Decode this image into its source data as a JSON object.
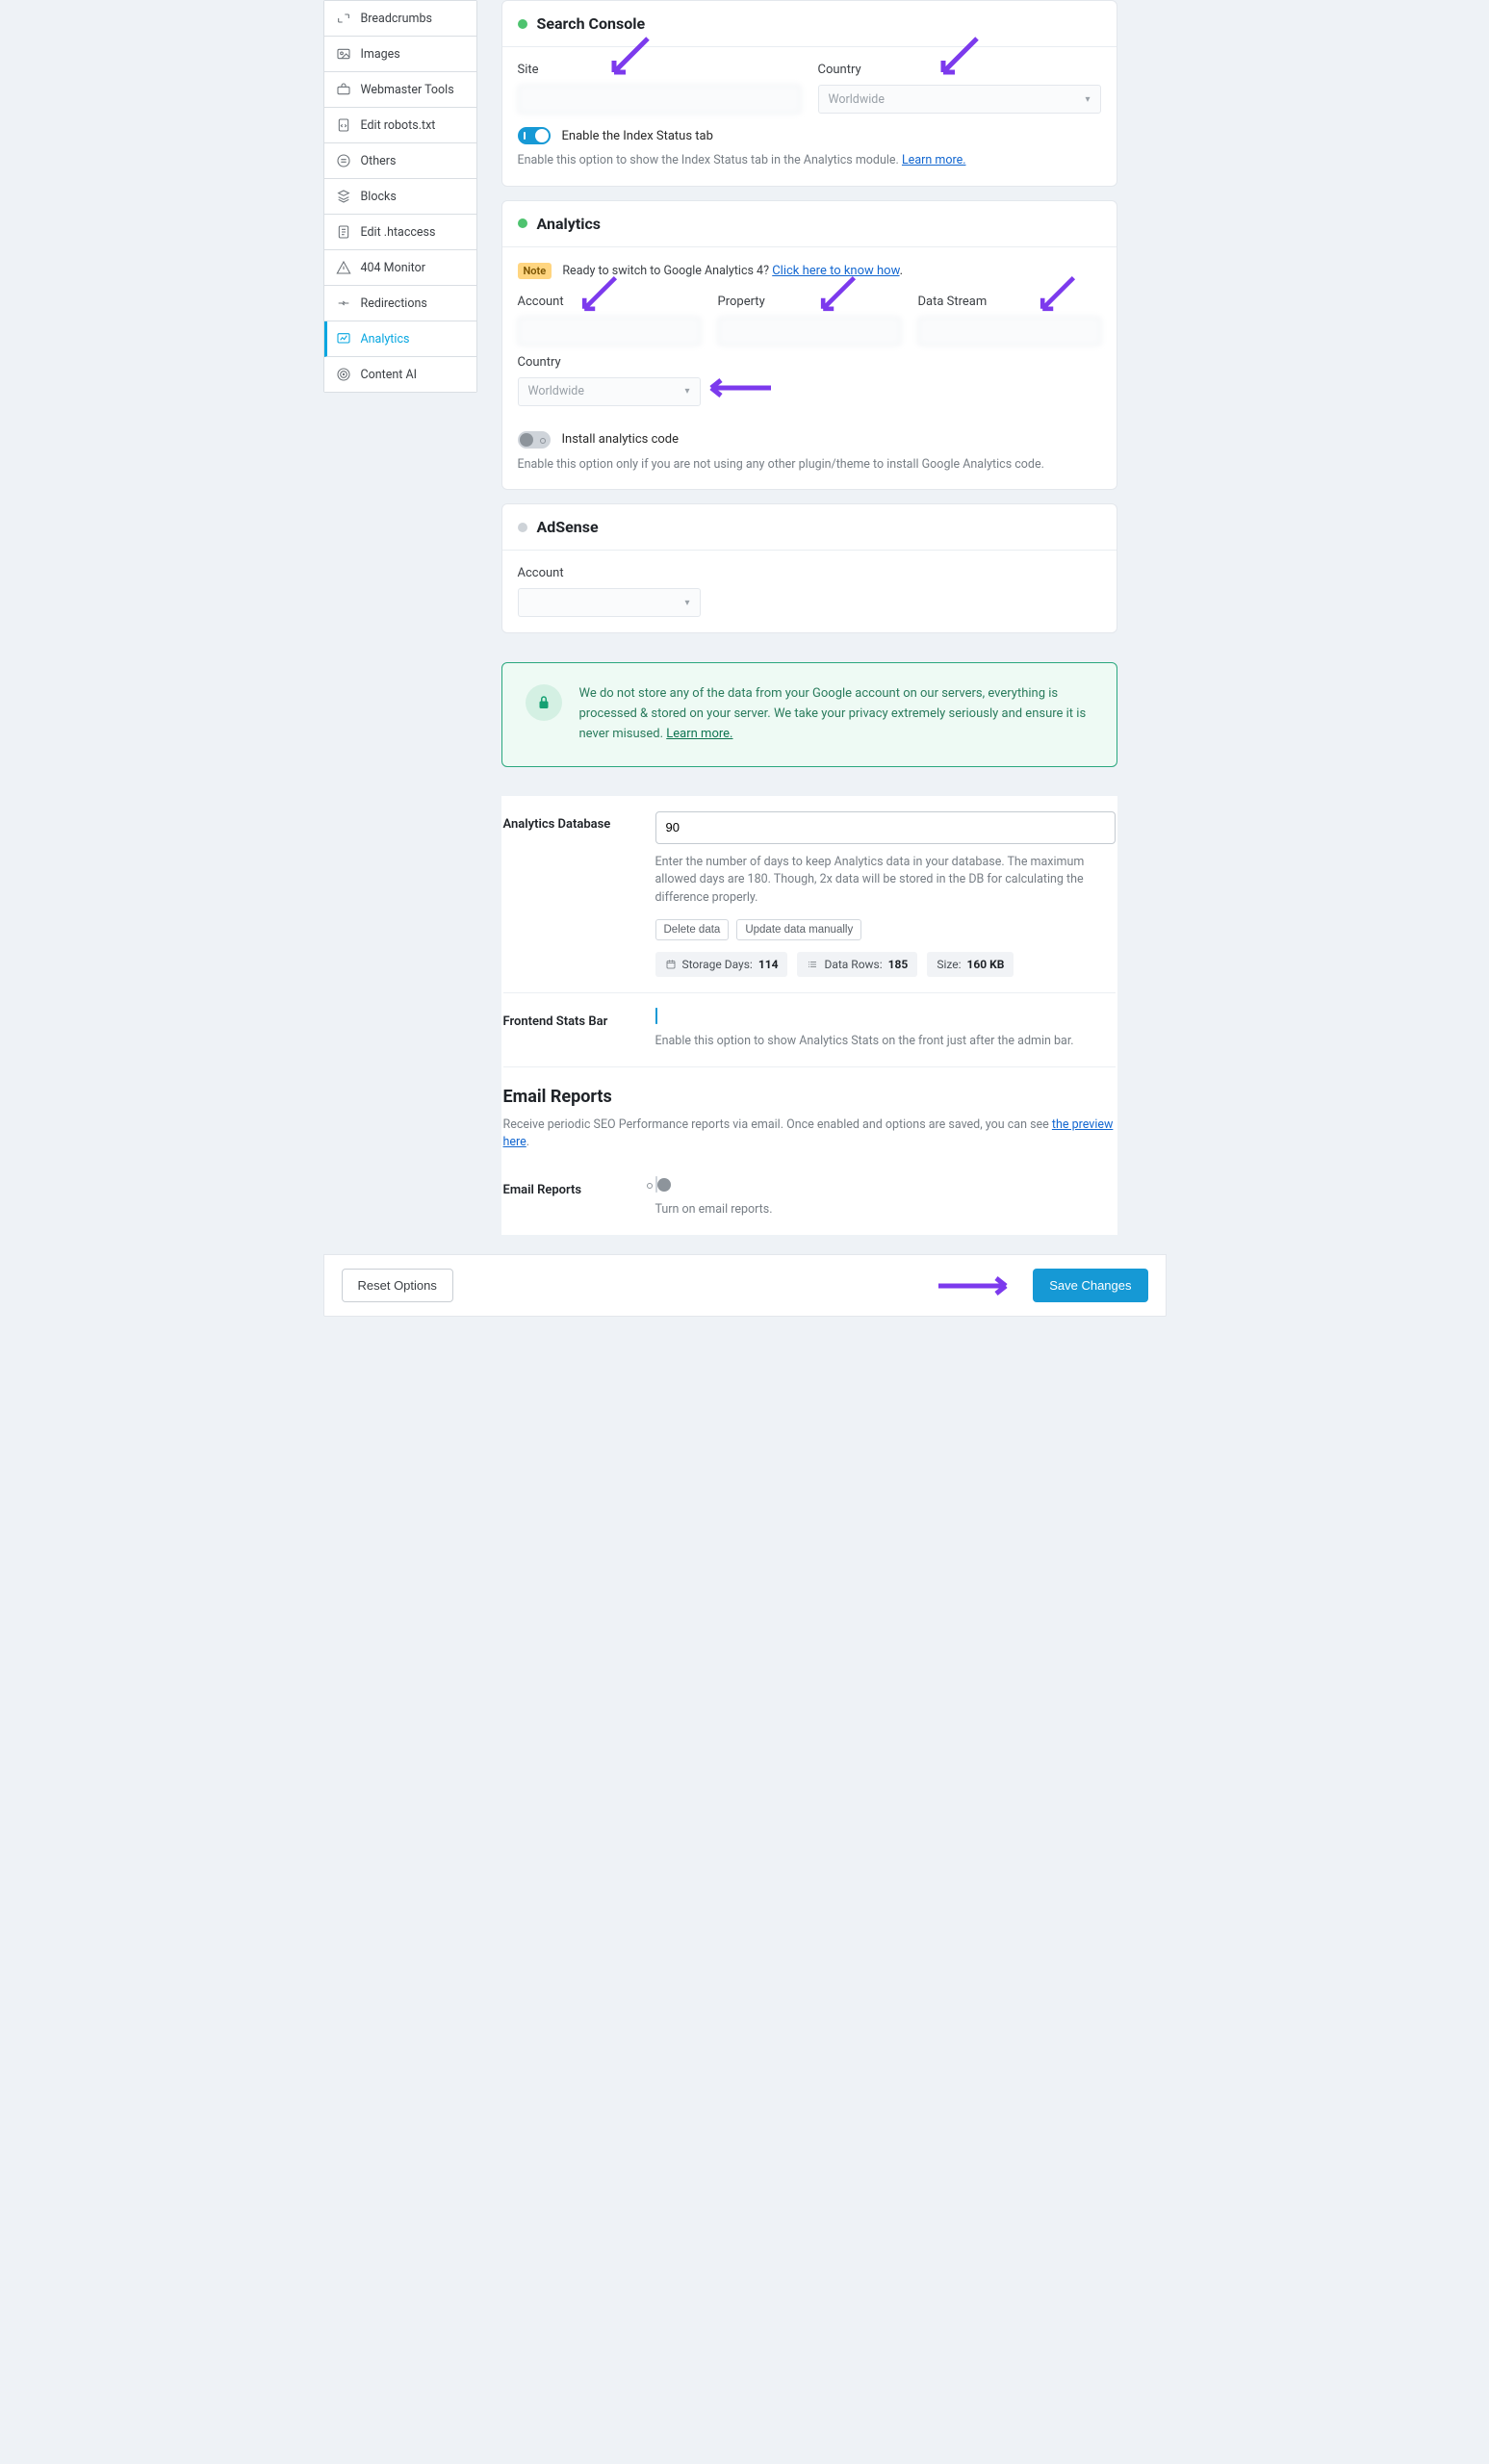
{
  "sidebar": {
    "items": [
      {
        "label": "Breadcrumbs"
      },
      {
        "label": "Images"
      },
      {
        "label": "Webmaster Tools"
      },
      {
        "label": "Edit robots.txt"
      },
      {
        "label": "Others"
      },
      {
        "label": "Blocks"
      },
      {
        "label": "Edit .htaccess"
      },
      {
        "label": "404 Monitor"
      },
      {
        "label": "Redirections"
      },
      {
        "label": "Analytics"
      },
      {
        "label": "Content AI"
      }
    ]
  },
  "search_console": {
    "title": "Search Console",
    "site_label": "Site",
    "country_label": "Country",
    "country_value": "Worldwide",
    "toggle_label": "Enable the Index Status tab",
    "help_text": "Enable this option to show the Index Status tab in the Analytics module.",
    "learn_more": "Learn more."
  },
  "analytics": {
    "title": "Analytics",
    "note_badge": "Note",
    "note_text": "Ready to switch to Google Analytics 4?",
    "note_link": "Click here to know how",
    "account_label": "Account",
    "property_label": "Property",
    "datastream_label": "Data Stream",
    "country_label": "Country",
    "country_value": "Worldwide",
    "install_toggle_label": "Install analytics code",
    "install_help": "Enable this option only if you are not using any other plugin/theme to install Google Analytics code."
  },
  "adsense": {
    "title": "AdSense",
    "account_label": "Account"
  },
  "privacy_box": {
    "text": "We do not store any of the data from your Google account on our servers, everything is processed & stored on your server. We take your privacy extremely seriously and ensure it is never misused.",
    "learn_more": "Learn more."
  },
  "db": {
    "label": "Analytics Database",
    "value": "90",
    "help": "Enter the number of days to keep Analytics data in your database. The maximum allowed days are 180. Though, 2x data will be stored in the DB for calculating the difference properly.",
    "delete_btn": "Delete data",
    "update_btn": "Update data manually",
    "chip_storage_label": "Storage Days:",
    "chip_storage_val": "114",
    "chip_rows_label": "Data Rows:",
    "chip_rows_val": "185",
    "chip_size_label": "Size:",
    "chip_size_val": "160 KB"
  },
  "stats_bar": {
    "label": "Frontend Stats Bar",
    "help": "Enable this option to show Analytics Stats on the front just after the admin bar."
  },
  "email_reports": {
    "heading": "Email Reports",
    "desc_pre": "Receive periodic SEO Performance reports via email. Once enabled and options are saved, you can see ",
    "desc_link": "the preview here",
    "toggle_label": "Email Reports",
    "toggle_help": "Turn on email reports."
  },
  "footer": {
    "reset": "Reset Options",
    "save": "Save Changes"
  }
}
